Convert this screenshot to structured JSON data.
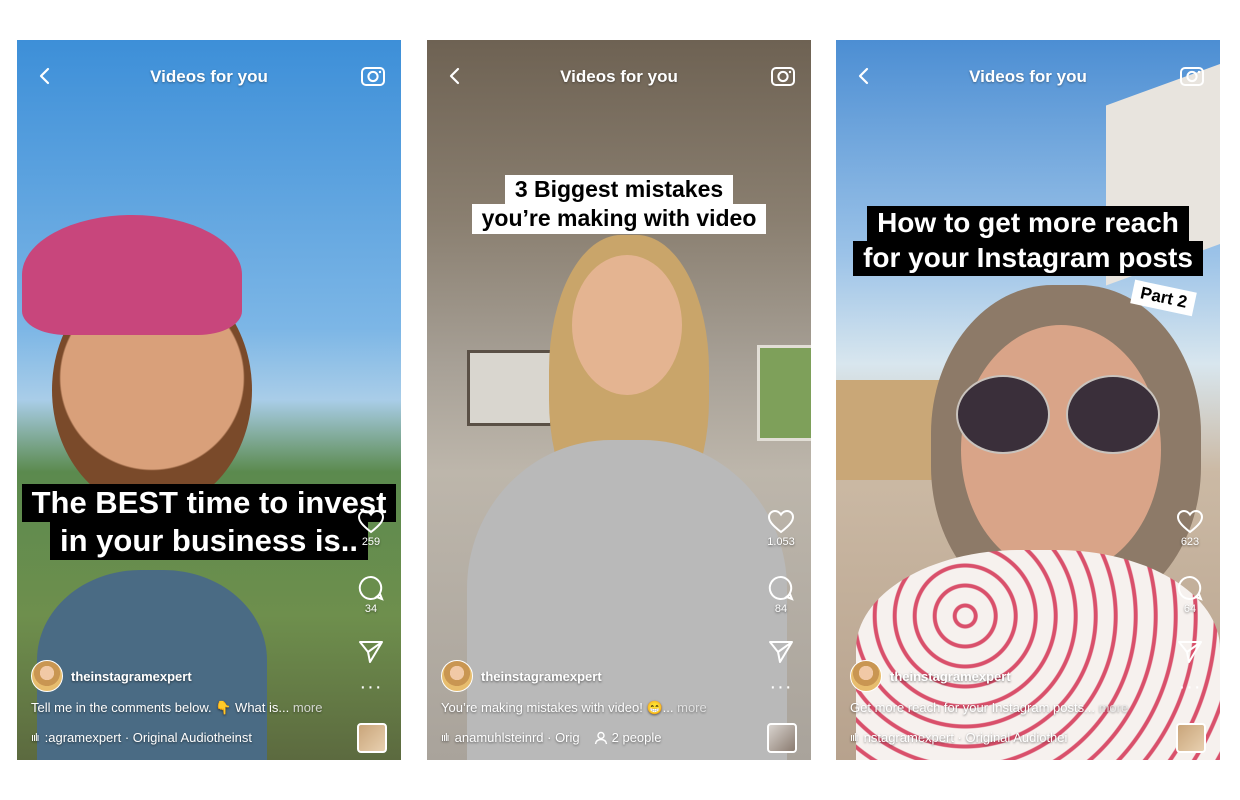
{
  "colors": {
    "overlay_text": "#ffffff",
    "caption_black_bg": "#000000",
    "caption_white_bg": "#ffffff"
  },
  "phones": [
    {
      "header_title": "Videos for you",
      "caption_lines": [
        "The BEST time to invest",
        "in your business is.."
      ],
      "likes": "259",
      "comments": "34",
      "username": "theinstagramexpert",
      "description": "Tell me in the comments below. 👇 What is...",
      "more_label": "more",
      "audio": ":agramexpert · Original Audiotheinst"
    },
    {
      "header_title": "Videos for you",
      "caption_lines": [
        "3 Biggest mistakes",
        "you’re making with video"
      ],
      "likes": "1.053",
      "comments": "84",
      "username": "theinstagramexpert",
      "description": "You’re making mistakes with video! 😁...",
      "more_label": "more",
      "audio": "anamuhlsteinrd · Orig",
      "people": "2 people"
    },
    {
      "header_title": "Videos for you",
      "caption_lines": [
        "How to get more reach",
        "for your Instagram posts"
      ],
      "sticker": "Part 2",
      "likes": "623",
      "comments": "64",
      "username": "theinstagramexpert",
      "description": "Get more reach for your Instagram posts...",
      "more_label": "more",
      "audio": "nstagramexpert · Original Audiothei"
    }
  ]
}
